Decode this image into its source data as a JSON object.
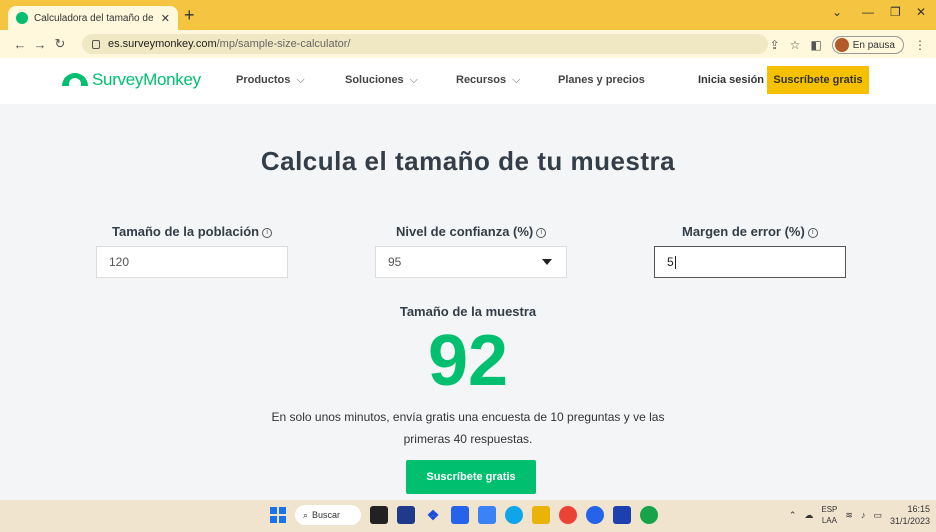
{
  "browser": {
    "tab_title": "Calculadora del tamaño de mue:",
    "tab_close": "✕",
    "new_tab": "+",
    "url_host": "es.surveymonkey.com",
    "url_path": "/mp/sample-size-calculator/",
    "profile_label": "En pausa"
  },
  "site": {
    "logo_text": "SurveyMonkey",
    "nav": [
      {
        "label": "Productos"
      },
      {
        "label": "Soluciones"
      },
      {
        "label": "Recursos"
      },
      {
        "label": "Planes y precios"
      }
    ],
    "login_label": "Inicia sesión",
    "cta_label": "Suscríbete gratis"
  },
  "calculator": {
    "title": "Calcula el tamaño de tu muestra",
    "population_label": "Tamaño de la población",
    "population_value": "120",
    "confidence_label": "Nivel de confianza (%)",
    "confidence_value": "95",
    "margin_label": "Margen de error (%)",
    "margin_value": "5",
    "info_glyph": "i",
    "result_label": "Tamaño de la muestra",
    "result_value": "92",
    "promo_line1": "En solo unos minutos, envía gratis una encuesta de 10 preguntas y ve las",
    "promo_line2": "primeras 40 respuestas.",
    "cta_label": "Suscríbete gratis"
  },
  "taskbar": {
    "search_label": "Buscar",
    "lang_top": "ESP",
    "lang_bottom": "LAA",
    "time": "16:15",
    "date": "31/1/2023"
  },
  "colors": {
    "brand_green": "#00bf6f",
    "cta_yellow": "#f5c000",
    "chrome_yellow": "#f5c542"
  }
}
